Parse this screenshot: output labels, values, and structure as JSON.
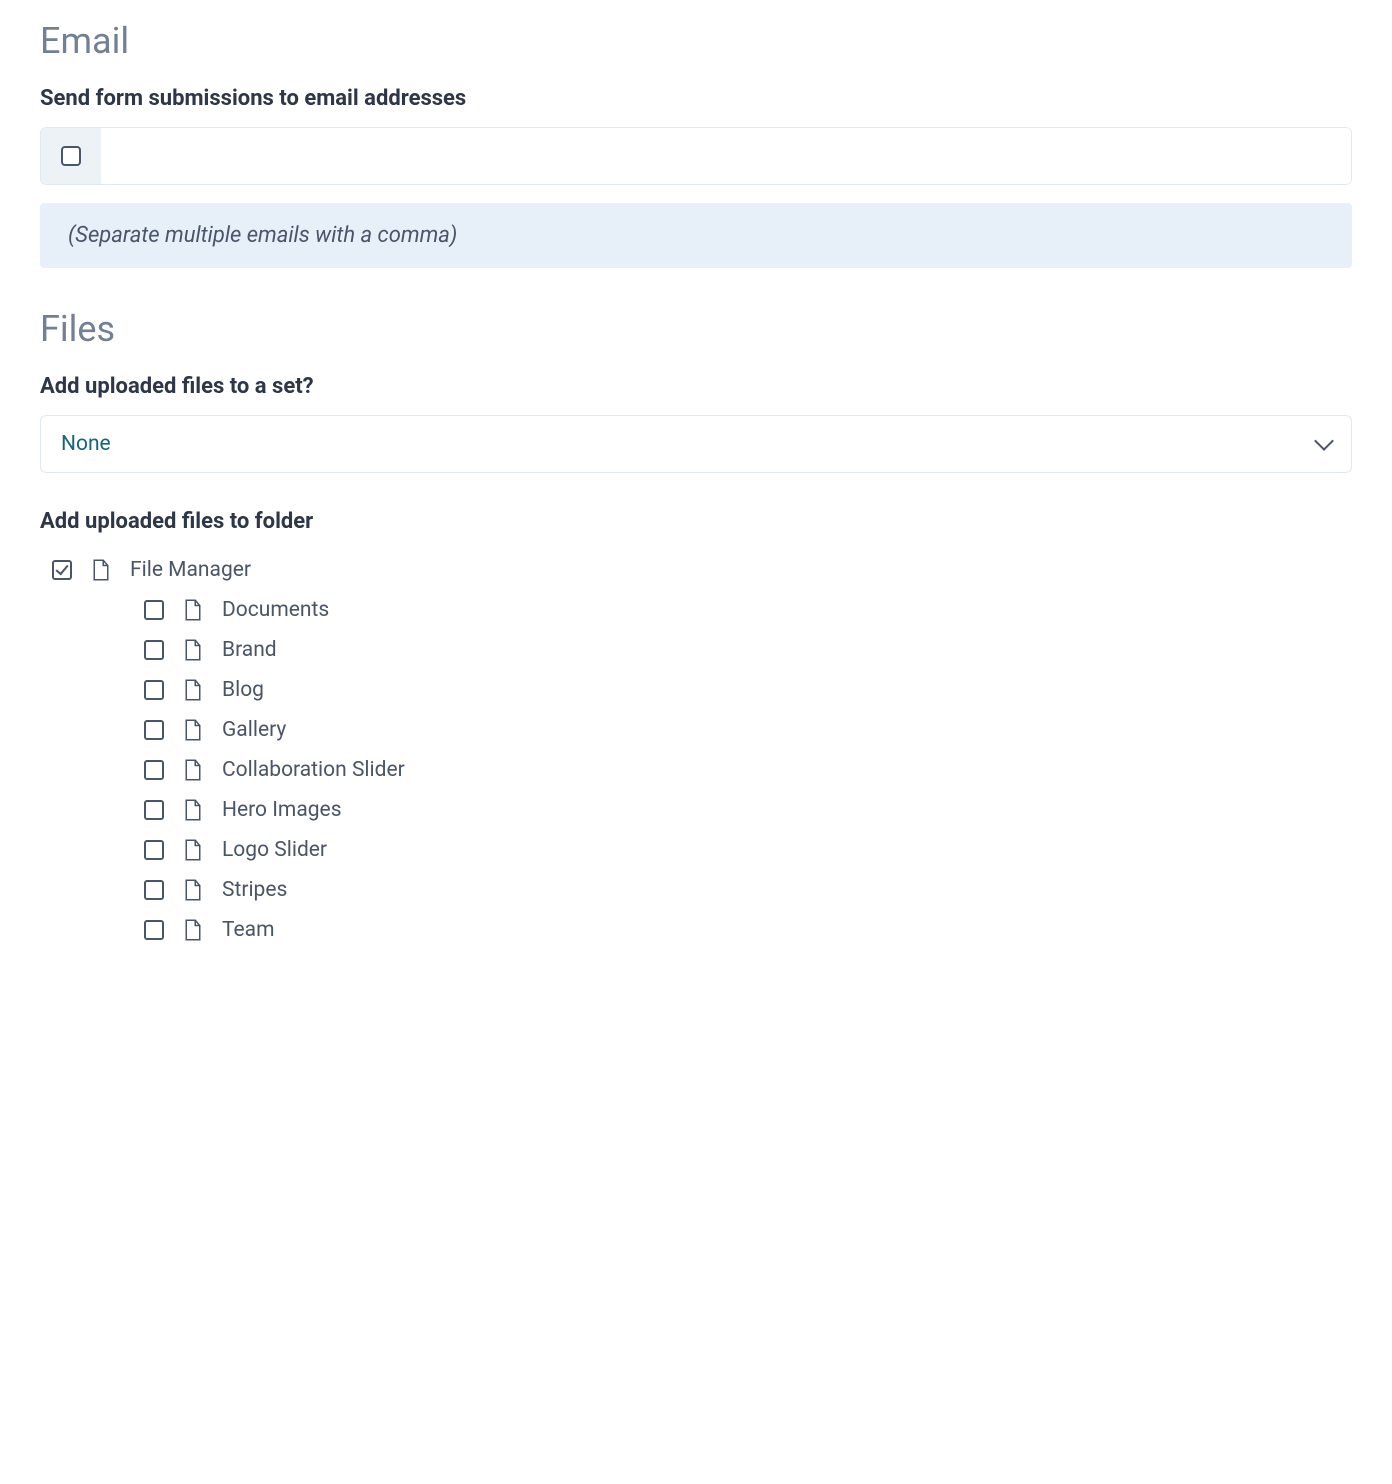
{
  "email": {
    "heading": "Email",
    "label": "Send form submissions to email addresses",
    "value": "",
    "hint": "(Separate multiple emails with a comma)"
  },
  "files": {
    "heading": "Files",
    "set_label": "Add uploaded files to a set?",
    "set_selected": "None",
    "folder_label": "Add uploaded files to folder",
    "tree": {
      "root": {
        "label": "File Manager",
        "checked": true
      },
      "children": [
        {
          "label": "Documents",
          "checked": false
        },
        {
          "label": "Brand",
          "checked": false
        },
        {
          "label": "Blog",
          "checked": false
        },
        {
          "label": "Gallery",
          "checked": false
        },
        {
          "label": "Collaboration Slider",
          "checked": false
        },
        {
          "label": "Hero Images",
          "checked": false
        },
        {
          "label": "Logo Slider",
          "checked": false
        },
        {
          "label": "Stripes",
          "checked": false
        },
        {
          "label": "Team",
          "checked": false
        }
      ]
    }
  }
}
